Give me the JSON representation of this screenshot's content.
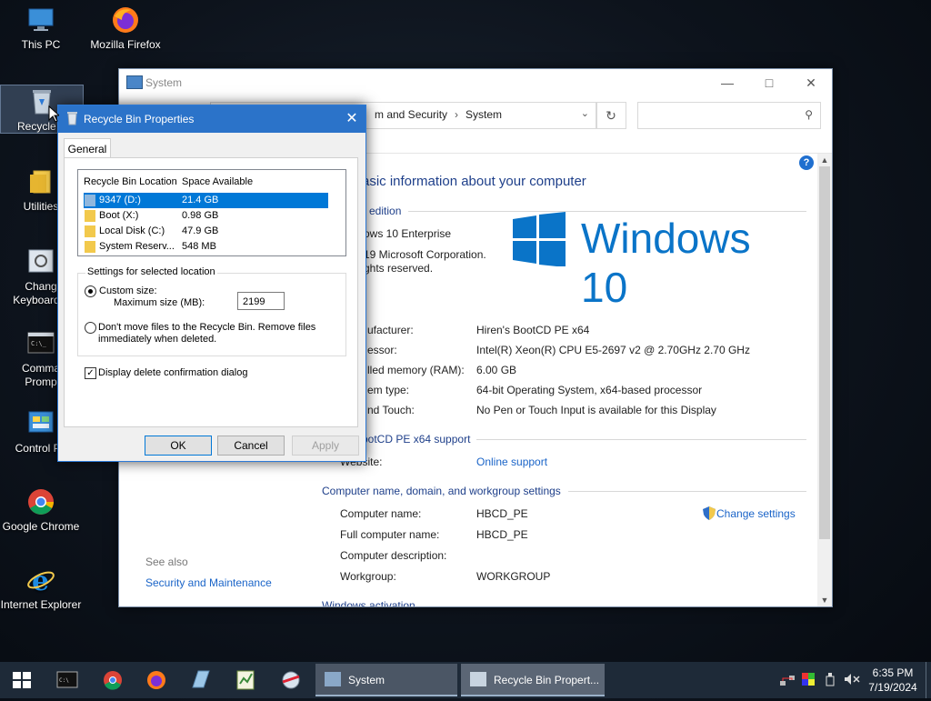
{
  "desktop": {
    "icons": [
      {
        "label": "This PC"
      },
      {
        "label": "Mozilla Firefox"
      },
      {
        "label": "Recycle B"
      },
      {
        "label": "Utilities"
      },
      {
        "label": "Chang\nKeyboard L"
      },
      {
        "label": "Comma\nPromp"
      },
      {
        "label": "Control Pa"
      },
      {
        "label": "Google Chrome"
      },
      {
        "label": "Internet Explorer"
      }
    ]
  },
  "system_window": {
    "title": "System",
    "breadcrumb": [
      "m and Security",
      "System"
    ],
    "heading": "asic information about your computer",
    "edition_title": "edition",
    "edition_name": "ows 10 Enterprise",
    "copyright_1": "19 Microsoft Corporation.",
    "copyright_2": "ghts reserved.",
    "logo_text": "Windows 10",
    "specs": [
      {
        "label": "ufacturer:",
        "value": "Hiren's BootCD PE x64"
      },
      {
        "label": "essor:",
        "value": "Intel(R) Xeon(R) CPU E5-2697 v2 @ 2.70GHz   2.70 GHz"
      },
      {
        "label": "lled memory (RAM):",
        "value": "6.00 GB"
      },
      {
        "label": "em type:",
        "value": "64-bit Operating System, x64-based processor"
      },
      {
        "label": "nd Touch:",
        "value": "No Pen or Touch Input is available for this Display"
      }
    ],
    "support_title": "ootCD PE x64 support",
    "website_label": "Website:",
    "website_value": "Online support",
    "comp_section_title": "Computer name, domain, and workgroup settings",
    "computer": [
      {
        "label": "Computer name:",
        "value": "HBCD_PE"
      },
      {
        "label": "Full computer name:",
        "value": "HBCD_PE"
      },
      {
        "label": "Computer description:",
        "value": ""
      },
      {
        "label": "Workgroup:",
        "value": "WORKGROUP"
      }
    ],
    "change_settings": "Change settings",
    "activation_title": "Windows activation",
    "see_also": "See also",
    "see_also_link": "Security and Maintenance",
    "help": "?"
  },
  "dialog": {
    "title": "Recycle Bin Properties",
    "tab": "General",
    "columns": [
      "Recycle Bin Location",
      "Space Available"
    ],
    "locations": [
      {
        "name": "9347 (D:)",
        "space": "21.4 GB",
        "selected": true
      },
      {
        "name": "Boot (X:)",
        "space": "0.98 GB",
        "selected": false
      },
      {
        "name": "Local Disk (C:)",
        "space": "47.9 GB",
        "selected": false
      },
      {
        "name": "System Reserv...",
        "space": "548 MB",
        "selected": false
      }
    ],
    "settings_title": "Settings for selected location",
    "custom_size": "Custom size:",
    "max_size_label": "Maximum size (MB):",
    "max_size_value": "2199",
    "dont_move_1": "Don't move files to the Recycle Bin. Remove files",
    "dont_move_2": "immediately when deleted.",
    "display_confirm": "Display delete confirmation dialog",
    "ok": "OK",
    "cancel": "Cancel",
    "apply": "Apply"
  },
  "taskbar": {
    "tasks": [
      {
        "label": "System"
      },
      {
        "label": "Recycle Bin Propert..."
      }
    ],
    "time": "6:35 PM",
    "date": "7/19/2024"
  },
  "colors": {
    "accent": "#0078d7",
    "title_blue": "#2b73c9",
    "heading_blue": "#1e3f8a",
    "link_blue": "#1a64c8",
    "windows_logo": "#0a74c8"
  }
}
